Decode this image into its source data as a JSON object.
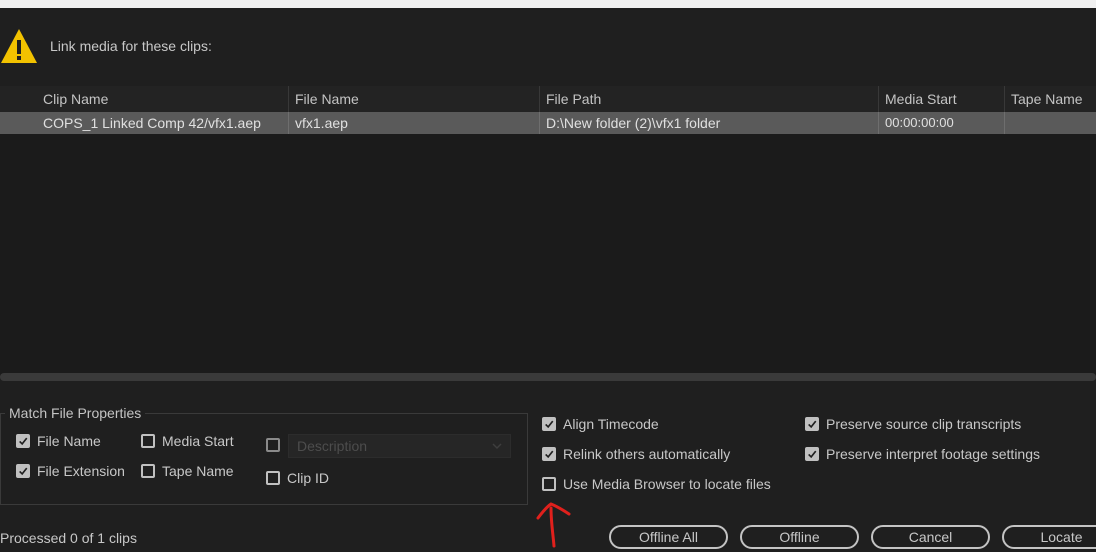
{
  "dialog": {
    "message": "Link media for these clips:",
    "status": "Processed 0 of 1 clips"
  },
  "table": {
    "columns": [
      "Clip Name",
      "File Name",
      "File Path",
      "Media Start",
      "Tape Name"
    ],
    "rows": [
      {
        "clip_name": "COPS_1 Linked Comp 42/vfx1.aep",
        "file_name": "vfx1.aep",
        "file_path": "D:\\New folder (2)\\vfx1 folder",
        "media_start": "00:00:00:00",
        "tape_name": ""
      }
    ]
  },
  "match_properties": {
    "legend": "Match File Properties",
    "file_name": {
      "label": "File Name",
      "checked": true
    },
    "file_extension": {
      "label": "File Extension",
      "checked": true
    },
    "media_start": {
      "label": "Media Start",
      "checked": false
    },
    "tape_name": {
      "label": "Tape Name",
      "checked": false
    },
    "description": {
      "label": "Description",
      "checked": false
    },
    "clip_id": {
      "label": "Clip ID",
      "checked": false
    }
  },
  "options": {
    "align_timecode": {
      "label": "Align Timecode",
      "checked": true
    },
    "relink_others": {
      "label": "Relink others automatically",
      "checked": true
    },
    "use_media_browser": {
      "label": "Use Media Browser to locate files",
      "checked": false
    },
    "preserve_transcripts": {
      "label": "Preserve source clip transcripts",
      "checked": true
    },
    "preserve_interpret": {
      "label": "Preserve interpret footage settings",
      "checked": true
    }
  },
  "buttons": {
    "offline_all": "Offline All",
    "offline": "Offline",
    "cancel": "Cancel",
    "locate": "Locate"
  },
  "colors": {
    "background": "#1f1f1f",
    "selected_row": "#5a5a5a",
    "warning": "#f2c200",
    "annotation_arrow": "#e0201c"
  }
}
